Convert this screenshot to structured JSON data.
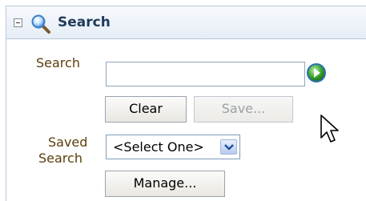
{
  "panel": {
    "title": "Search",
    "toggle_icon": "collapse-minus-icon",
    "title_icon": "magnifier-icon"
  },
  "form": {
    "search_label": "Search",
    "search_value": "",
    "search_placeholder": "",
    "go_icon": "go-arrow-icon",
    "clear_label": "Clear",
    "save_label": "Save...",
    "saved_search_label_line1": "Saved",
    "saved_search_label_line2": "Search",
    "saved_search_selected": "<Select One>",
    "manage_label": "Manage..."
  },
  "colors": {
    "label": "#5b3d0a",
    "title": "#1f3b5a",
    "border": "#b9c7da",
    "go_green": "#3aa52a"
  },
  "cursor": "mouse-pointer-icon"
}
